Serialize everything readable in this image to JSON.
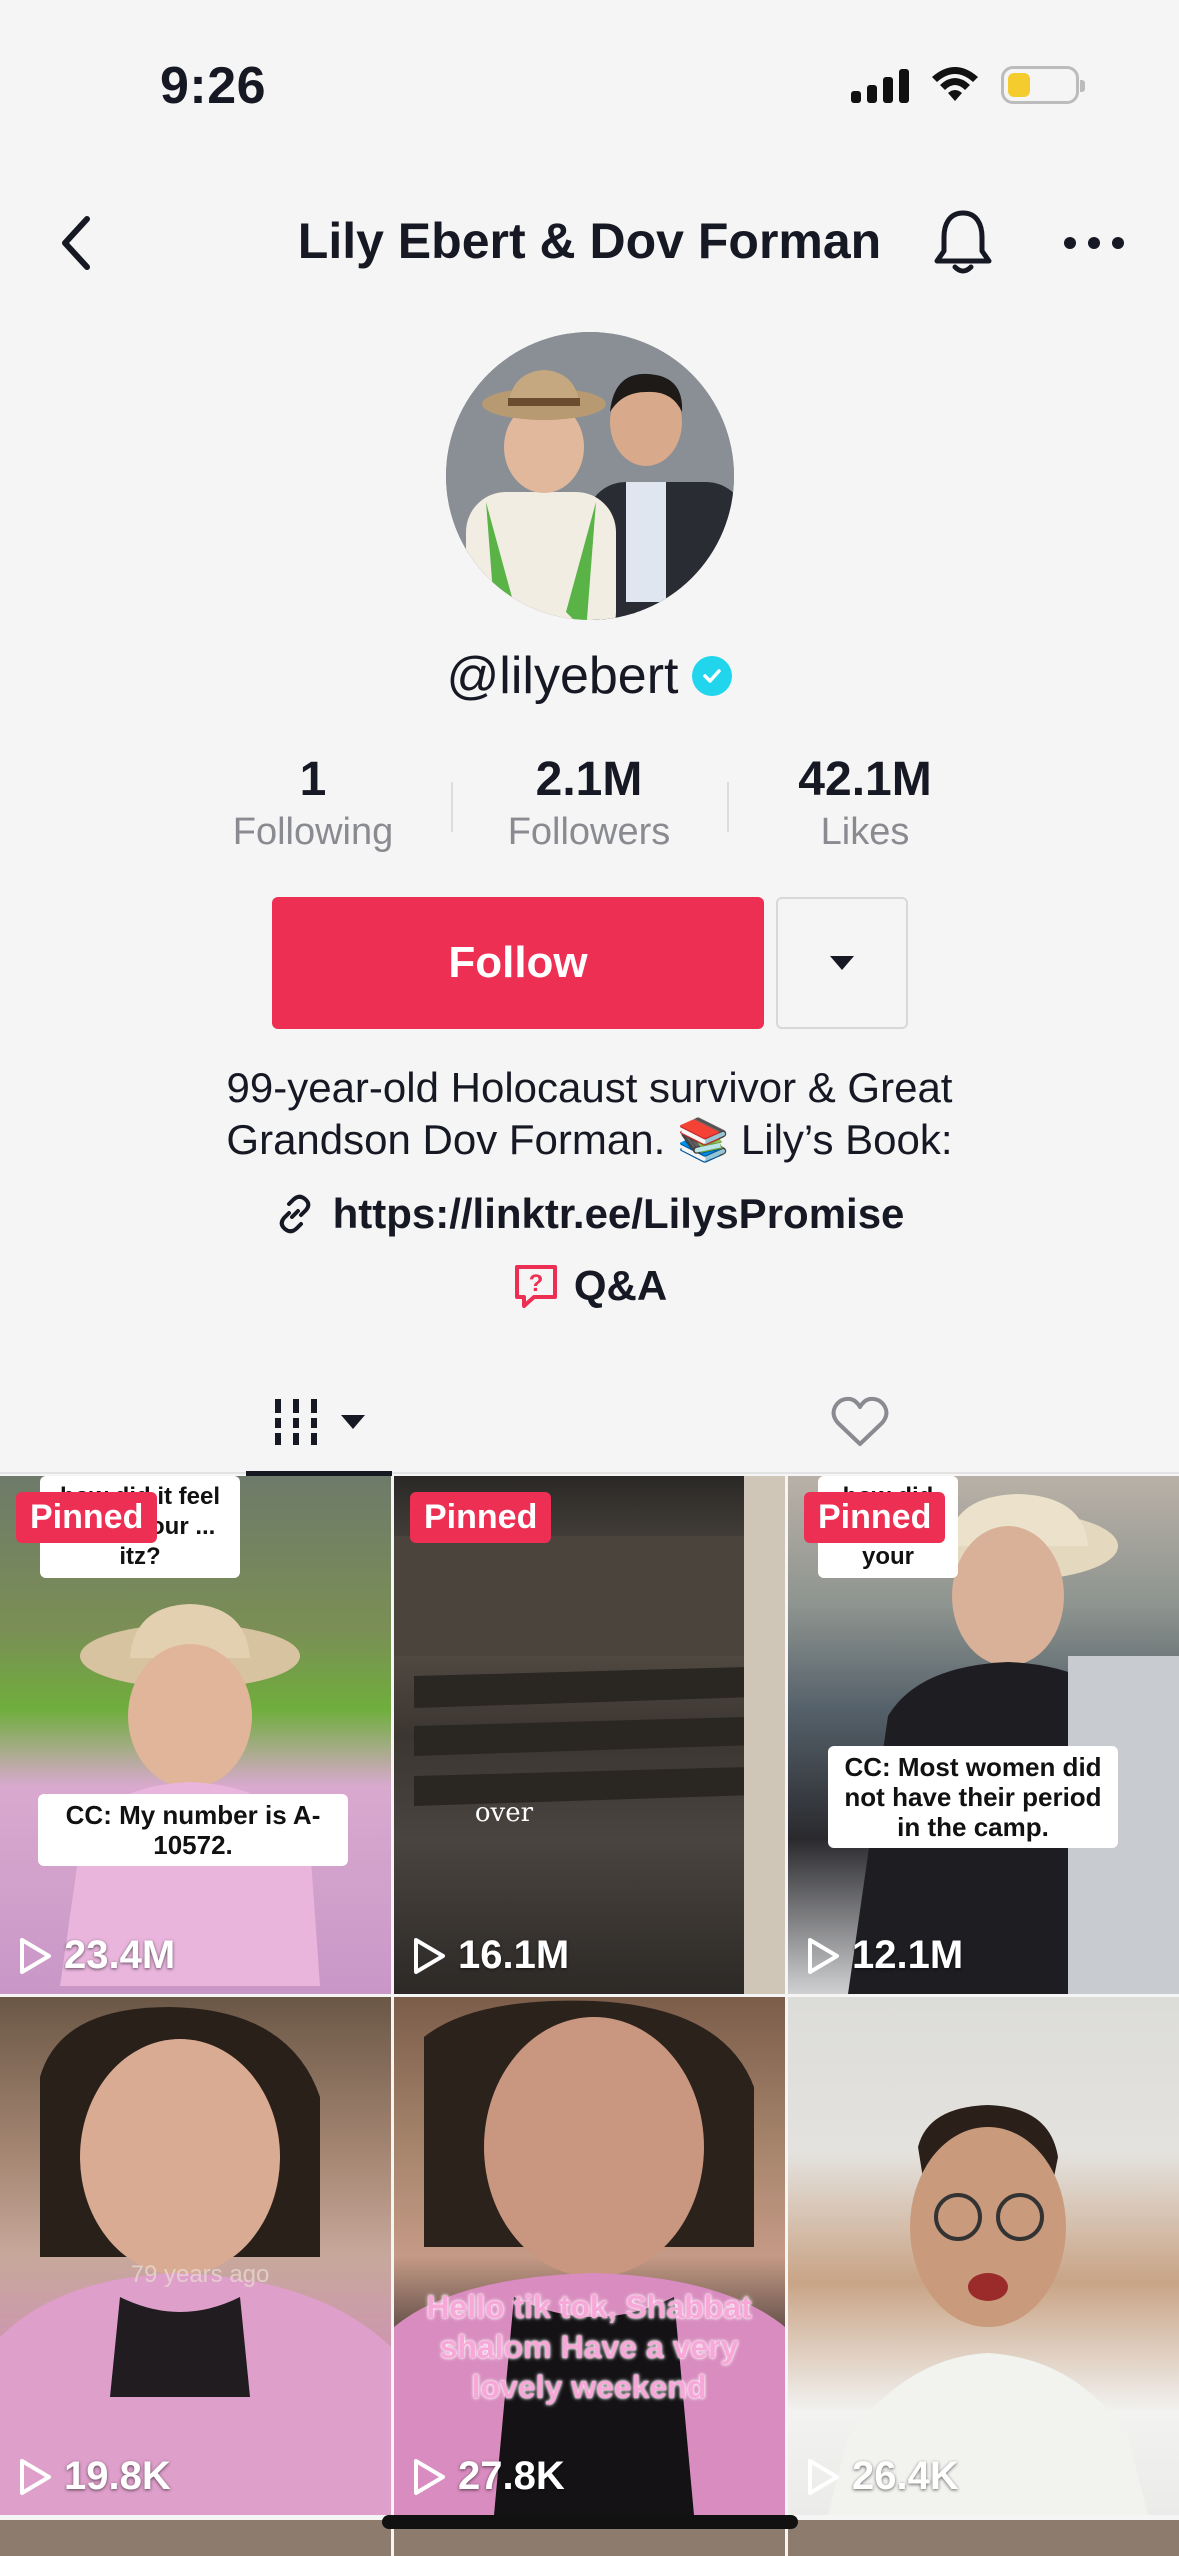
{
  "status_bar": {
    "time": "9:26",
    "icons": [
      "signal-icon",
      "wifi-icon",
      "battery-icon"
    ],
    "battery_color": "#f5cc2e"
  },
  "nav": {
    "title": "Lily Ebert & Dov Forman",
    "back_icon": "chevron-left-icon",
    "bell_icon": "bell-icon",
    "more_icon": "more-icon"
  },
  "profile": {
    "handle": "@lilyebert",
    "verified": true,
    "stats": [
      {
        "value": "1",
        "label": "Following"
      },
      {
        "value": "2.1M",
        "label": "Followers"
      },
      {
        "value": "42.1M",
        "label": "Likes"
      }
    ],
    "follow_label": "Follow",
    "bio_line1": "99-year-old Holocaust survivor & Great",
    "bio_line2": "Grandson Dov Forman. 📚 Lily’s Book:",
    "link": "https://linktr.ee/LilysPromise",
    "qa_label": "Q&A"
  },
  "colors": {
    "accent": "#ee2f54",
    "verified": "#20d5ec",
    "text": "#161823",
    "muted": "#8a8b91"
  },
  "tabs": [
    {
      "icon": "videos-grid-icon",
      "active": true
    },
    {
      "icon": "heart-icon",
      "active": false
    }
  ],
  "videos": [
    {
      "pinned": "Pinned",
      "views": "23.4M",
      "caption_top": "how did it feel to get your ... itz?",
      "caption": "CC: My number is A-10572."
    },
    {
      "pinned": "Pinned",
      "views": "16.1M",
      "caption": "over"
    },
    {
      "pinned": "Pinned",
      "views": "12.1M",
      "caption_top": "how did you do on your",
      "caption": "CC: Most women did not have their period in the camp."
    },
    {
      "views": "19.8K",
      "caption": "79 years ago"
    },
    {
      "views": "27.8K",
      "caption": "Hello tik tok, Shabbat shalom Have a very lovely weekend"
    },
    {
      "views": "26.4K"
    }
  ]
}
